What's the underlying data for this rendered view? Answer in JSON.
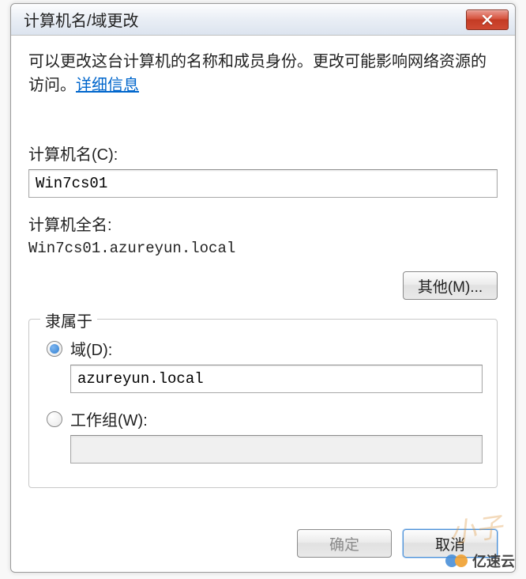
{
  "title": "计算机名/域更改",
  "description_part1": "可以更改这台计算机的名称和成员身份。更改可能影响网络资源的访问。",
  "description_link": "详细信息",
  "computer_name_label": "计算机名(C):",
  "computer_name_value": "Win7cs01",
  "full_name_label": "计算机全名:",
  "full_name_value": "Win7cs01.azureyun.local",
  "more_button": "其他(M)...",
  "member_of": {
    "title": "隶属于",
    "domain_label": "域(D):",
    "domain_value": "azureyun.local",
    "workgroup_label": "工作组(W):",
    "workgroup_value": "",
    "selected": "domain"
  },
  "buttons": {
    "ok": "确定",
    "cancel": "取消"
  },
  "watermark": {
    "text": "亿速云",
    "script": "小子"
  }
}
